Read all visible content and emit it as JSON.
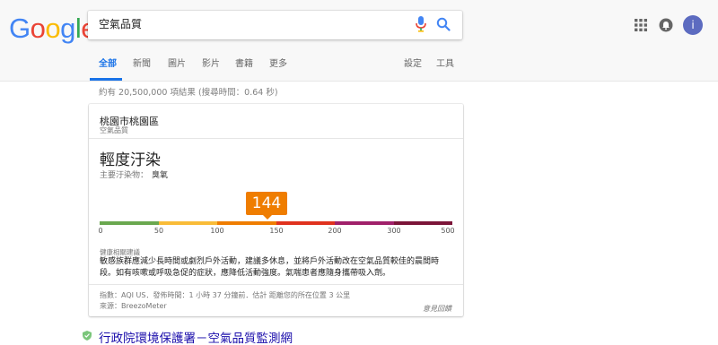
{
  "logo": {
    "letters": [
      "G",
      "o",
      "o",
      "g",
      "l",
      "e"
    ],
    "colors": [
      "#4285F4",
      "#EA4335",
      "#FBBC05",
      "#4285F4",
      "#34A853",
      "#EA4335"
    ]
  },
  "search": {
    "value": "空氣品質",
    "icons": [
      "mic-icon",
      "search-icon"
    ]
  },
  "header_icons": {
    "apps": "apps-grid-icon",
    "notifications": "notifications-icon",
    "avatar_letter": "i"
  },
  "tabs": [
    {
      "label": "全部",
      "active": true
    },
    {
      "label": "新聞",
      "active": false
    },
    {
      "label": "圖片",
      "active": false
    },
    {
      "label": "影片",
      "active": false
    },
    {
      "label": "書籍",
      "active": false
    },
    {
      "label": "更多",
      "active": false
    }
  ],
  "tools": {
    "settings": "設定",
    "tools": "工具"
  },
  "stats_text": "約有 20,500,000 項結果 (搜尋時間：0.64 秒)",
  "aqi_card": {
    "location": "桃園市桃園區",
    "subtitle": "空氣品質",
    "level": "輕度汙染",
    "pollutant_label": "主要汙染物：",
    "pollutant_value": "臭氧",
    "aqi_value": "144",
    "scale_ticks": [
      "0",
      "50",
      "100",
      "150",
      "200",
      "300",
      "500"
    ],
    "scale_colors": [
      "#6aa84f",
      "#f9bc38",
      "#ef7d00",
      "#e0321e",
      "#a0206a",
      "#7b1438"
    ],
    "advice_title": "健康相關建議",
    "advice_text": "敏感族群應減少長時間或劇烈戶外活動，建議多休息，並將戶外活動改在空氣品質較佳的晨間時段。如有咳嗽或呼吸急促的症狀，應降低活動強度。氣喘患者應隨身攜帶吸入劑。",
    "meta_line1": "指數：AQI US．發佈時間：1 小時 37 分鐘前．估計 距離您的所在位置 3 公里",
    "meta_line2": "來源：BreezoMeter",
    "feedback": "意見回饋"
  },
  "first_result": {
    "title": "行政院環境保護署－空氣品質監測網"
  }
}
